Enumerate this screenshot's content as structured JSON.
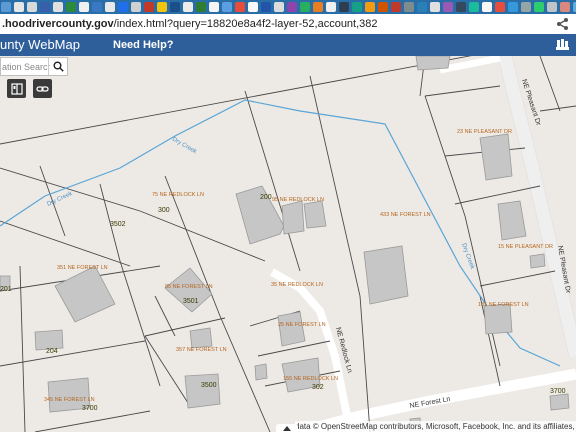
{
  "browser": {
    "url_host": ".hoodrivercounty.gov",
    "url_path": "/index.html?query=18820e8a4f2-layer-52,account,382",
    "tab_favicon_colors": [
      "#5c9ad6",
      "#e6e6e6",
      "#d9d9d9",
      "#3a5faa",
      "#e0e0e0",
      "#2b8a3e",
      "#f0f0f0",
      "#3b78c4",
      "#e8e8e8",
      "#1f6feb",
      "#d0d0d0",
      "#c0392b",
      "#f1c40f",
      "#1b4f8a",
      "#ececec",
      "#2e7d32",
      "#f5f5f5",
      "#5aa0e0",
      "#e74c3c",
      "#fafafa",
      "#2255aa",
      "#dcdcdc",
      "#8e44ad",
      "#27ae60",
      "#e67e22",
      "#f0f0f0",
      "#2c3e50",
      "#16a085",
      "#f39c12",
      "#d35400",
      "#c0392b",
      "#7f8c8d",
      "#2980b9",
      "#e0e0e0",
      "#9b59b6",
      "#34495e",
      "#1abc9c",
      "#f7f7f7",
      "#e74c3c",
      "#3498db",
      "#95a5a6",
      "#2ecc71",
      "#bdc3c7",
      "#d98880",
      "#5dade2",
      "#f4d03f",
      "#48c9b0",
      "#eeeeee",
      "#a569bd",
      "#f8c471"
    ]
  },
  "header": {
    "title": "unty WebMap",
    "help_label": "Need Help?"
  },
  "search": {
    "placeholder": "ation Search"
  },
  "map": {
    "water_labels": [
      "Dry Creek",
      "Dry Creek",
      "Dry Creek"
    ],
    "road_labels": [
      "NE Pleasant Dr",
      "NE Pleasant Dr",
      "NE Redlock Ln",
      "NE Forest Ln"
    ],
    "address_labels": [
      "75 NE REDLOCK LN",
      "95 NE REDLOCK LN",
      "433 NE FOREST LN",
      "23 NE PLEASANT DR",
      "15 NE PLEASANT DR",
      "351 NE FOREST LN",
      "85 NE FOREST LN",
      "35 NE REDLOCK LN",
      "25 NE FOREST LN",
      "135 NE FOREST LN",
      "357 NE FOREST LN",
      "155 NE REDLOCK LN",
      "345 NE FOREST LN"
    ],
    "parcel_numbers": [
      "300",
      "3502",
      "200",
      "3501",
      "201",
      "204",
      "3500",
      "302",
      "3700",
      "3700"
    ]
  },
  "attribution": "data © OpenStreetMap contributors, Microsoft, Facebook, Inc. and its affiliates, Esri Community",
  "colors": {
    "header_bg": "#2f5f9a",
    "map_bg": "#edeae6",
    "stream": "#5aa5d6",
    "address_label": "#b5651d",
    "parcel_label": "#c2c200"
  }
}
